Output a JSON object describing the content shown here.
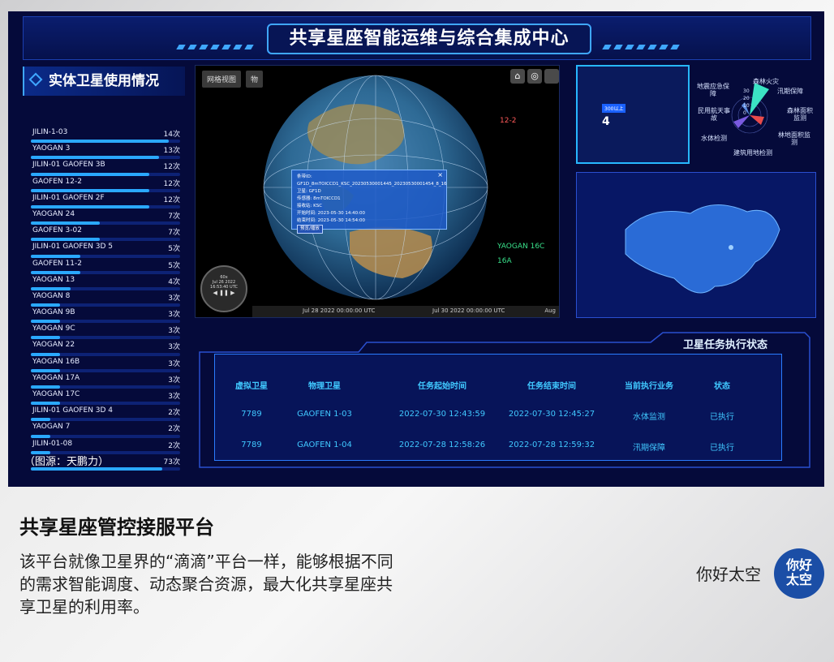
{
  "dashboard": {
    "header_title": "共享星座智能运维与综合集成中心",
    "left_panel": {
      "title": "实体卫星使用情况",
      "items": [
        {
          "name": "JILIN-1-03",
          "count": "14次",
          "level": 1.0
        },
        {
          "name": "YAOGAN 3",
          "count": "13次",
          "level": 0.93
        },
        {
          "name": "JILIN-01 GAOFEN 3B",
          "count": "12次",
          "level": 0.86
        },
        {
          "name": "GAOFEN 12-2",
          "count": "12次",
          "level": 0.86
        },
        {
          "name": "JILIN-01 GAOFEN 2F",
          "count": "12次",
          "level": 0.86
        },
        {
          "name": "YAOGAN 24",
          "count": "7次",
          "level": 0.5
        },
        {
          "name": "GAOFEN 3-02",
          "count": "7次",
          "level": 0.5
        },
        {
          "name": "JILIN-01 GAOFEN 3D 5",
          "count": "5次",
          "level": 0.36
        },
        {
          "name": "GAOFEN 11-2",
          "count": "5次",
          "level": 0.36
        },
        {
          "name": "YAOGAN 13",
          "count": "4次",
          "level": 0.29
        },
        {
          "name": "YAOGAN 8",
          "count": "3次",
          "level": 0.21
        },
        {
          "name": "YAOGAN 9B",
          "count": "3次",
          "level": 0.21
        },
        {
          "name": "YAOGAN 9C",
          "count": "3次",
          "level": 0.21
        },
        {
          "name": "YAOGAN 22",
          "count": "3次",
          "level": 0.21
        },
        {
          "name": "YAOGAN 16B",
          "count": "3次",
          "level": 0.21
        },
        {
          "name": "YAOGAN 17A",
          "count": "3次",
          "level": 0.21
        },
        {
          "name": "YAOGAN 17C",
          "count": "3次",
          "level": 0.21
        },
        {
          "name": "JILIN-01 GAOFEN 3D 4",
          "count": "2次",
          "level": 0.14
        },
        {
          "name": "YAOGAN 7",
          "count": "2次",
          "level": 0.14
        },
        {
          "name": "JILIN-01-08",
          "count": "2次",
          "level": 0.14
        },
        {
          "name": "",
          "count": "73次",
          "level": 0.95
        }
      ]
    },
    "globe": {
      "tabs": [
        "网格视图",
        "物"
      ],
      "popup_lines": [
        "条带ID: GF1D_8mTOICCD1_KSC_20230530001445_20230530001454_8_16",
        "卫星: GF1D",
        "传感器: 8mTOICCD1",
        "接收站: KSC",
        "开始时间: 2023-05-30 14:40:00",
        "结束时间: 2023-05-30 14:54:00"
      ],
      "popup_button": "预览/播放",
      "timeline_labels": [
        "Jul 28 2022 00:00:00 UTC",
        "Jul 30 2022 00:00:00 UTC",
        "Aug"
      ],
      "clock_lines": [
        "60x",
        "Jul 26 2022",
        "16:53:40 UTC"
      ]
    },
    "badge": {
      "label": "300以上",
      "value": "4"
    },
    "rose": {
      "labels": [
        "森林火灾",
        "汛期保障",
        "森林面积监测",
        "林地面积监测",
        "建筑用地检测",
        "水体检测",
        "民用航天事故",
        "地震应急保障"
      ],
      "ticks": [
        "30",
        "20",
        "10",
        "0"
      ]
    },
    "table": {
      "title": "卫星任务执行状态",
      "headers": [
        "虚拟卫星",
        "物理卫星",
        "任务起始时间",
        "任务结束时间",
        "当前执行业务",
        "状态"
      ],
      "rows": [
        [
          "7789",
          "GAOFEN 1-03",
          "2022-07-30 12:43:59",
          "2022-07-30 12:45:27",
          "水体监测",
          "已执行"
        ],
        [
          "7789",
          "GAOFEN 1-04",
          "2022-07-28 12:58:26",
          "2022-07-28 12:59:32",
          "汛期保障",
          "已执行"
        ]
      ]
    },
    "source": "（图源：天鹏力）"
  },
  "caption": {
    "title": "共享星座管控接服平台",
    "body": "该平台就像卫星界的“滴滴”平台一样，能够根据不同的需求智能调度、动态聚合资源，最大化共享星座共享卫星的利用率。"
  },
  "brand": {
    "name": "你好太空",
    "logo_text": "你好 太空"
  }
}
